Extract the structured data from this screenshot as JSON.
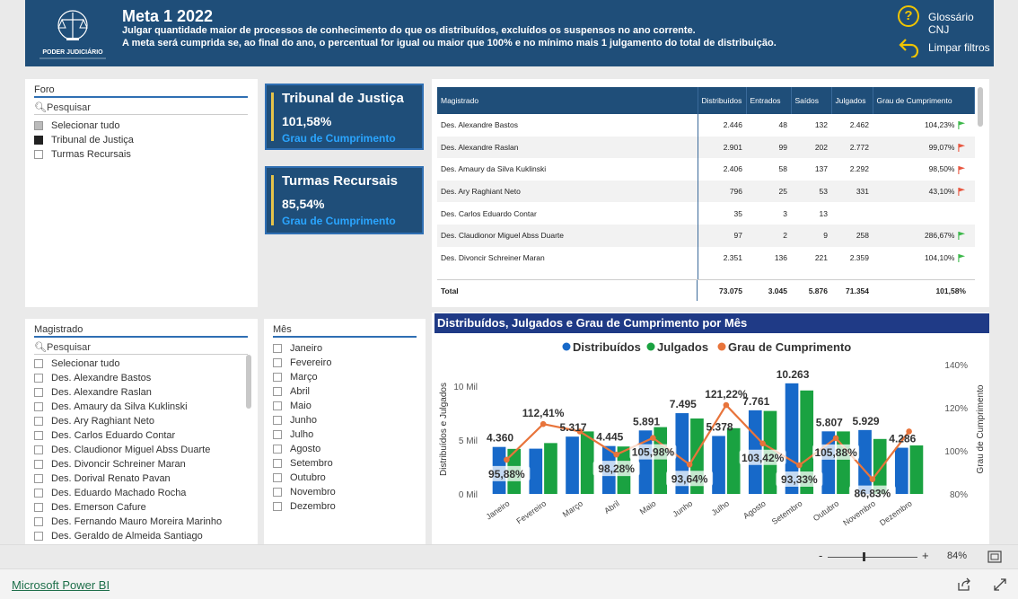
{
  "header": {
    "title": "Meta 1 2022",
    "desc1": "Julgar quantidade maior de processos de conhecimento do que os distribuídos, excluídos os suspensos no ano corrente.",
    "desc2": "A meta será cumprida se, ao final do ano, o percentual for igual ou maior que 100% e no mínimo mais 1 julgamento do total de distribuição.",
    "logo_text": "PODER JUDICIÁRIO",
    "glossario": "Glossário CNJ",
    "limpar": "Limpar filtros"
  },
  "foro_slicer": {
    "title": "Foro",
    "search": "Pesquisar",
    "options": [
      "Selecionar tudo",
      "Tribunal de Justiça",
      "Turmas Recursais"
    ]
  },
  "cards": [
    {
      "title": "Tribunal de Justiça",
      "value": "101,58%",
      "label": "Grau de Cumprimento"
    },
    {
      "title": "Turmas Recursais",
      "value": "85,54%",
      "label": "Grau de Cumprimento"
    }
  ],
  "table": {
    "headers": [
      "Magistrado",
      "Distribuídos",
      "Entrados",
      "Saídos",
      "Julgados",
      "Grau de Cumprimento"
    ],
    "rows": [
      {
        "name": "Des. Alexandre Bastos",
        "dist": "2.446",
        "ent": "48",
        "sai": "132",
        "jul": "2.462",
        "grau": "104,23%",
        "flag": "green"
      },
      {
        "name": "Des. Alexandre Raslan",
        "dist": "2.901",
        "ent": "99",
        "sai": "202",
        "jul": "2.772",
        "grau": "99,07%",
        "flag": "red"
      },
      {
        "name": "Des. Amaury da Silva Kuklinski",
        "dist": "2.406",
        "ent": "58",
        "sai": "137",
        "jul": "2.292",
        "grau": "98,50%",
        "flag": "red"
      },
      {
        "name": "Des. Ary Raghiant Neto",
        "dist": "796",
        "ent": "25",
        "sai": "53",
        "jul": "331",
        "grau": "43,10%",
        "flag": "red"
      },
      {
        "name": "Des. Carlos Eduardo Contar",
        "dist": "35",
        "ent": "3",
        "sai": "13",
        "jul": "",
        "grau": "",
        "flag": ""
      },
      {
        "name": "Des. Claudionor Miguel Abss Duarte",
        "dist": "97",
        "ent": "2",
        "sai": "9",
        "jul": "258",
        "grau": "286,67%",
        "flag": "green"
      },
      {
        "name": "Des. Divoncir Schreiner Maran",
        "dist": "2.351",
        "ent": "136",
        "sai": "221",
        "jul": "2.359",
        "grau": "104,10%",
        "flag": "green"
      }
    ],
    "total": {
      "label": "Total",
      "dist": "73.075",
      "ent": "3.045",
      "sai": "5.876",
      "jul": "71.354",
      "grau": "101,58%"
    }
  },
  "magistrado_slicer": {
    "title": "Magistrado",
    "search": "Pesquisar",
    "options": [
      "Selecionar tudo",
      "Des. Alexandre Bastos",
      "Des. Alexandre Raslan",
      "Des. Amaury da Silva Kuklinski",
      "Des. Ary Raghiant Neto",
      "Des. Carlos Eduardo Contar",
      "Des. Claudionor Miguel Abss Duarte",
      "Des. Divoncir Schreiner Maran",
      "Des. Dorival Renato Pavan",
      "Des. Eduardo Machado Rocha",
      "Des. Emerson Cafure",
      "Des. Fernando Mauro Moreira Marinho",
      "Des. Geraldo de Almeida Santiago"
    ]
  },
  "mes_slicer": {
    "title": "Mês",
    "options": [
      "Janeiro",
      "Fevereiro",
      "Março",
      "Abril",
      "Maio",
      "Junho",
      "Julho",
      "Agosto",
      "Setembro",
      "Outubro",
      "Novembro",
      "Dezembro"
    ]
  },
  "colors": {
    "dist": "#1769c9",
    "jul": "#1aa241",
    "grau": "#e8743b",
    "navy": "#1f4e79",
    "green_flag": "#3cb84a",
    "red_flag": "#e8563f"
  },
  "chart_data": {
    "type": "bar",
    "title": "Distribuídos, Julgados e Grau de Cumprimento por Mês",
    "categories": [
      "Janeiro",
      "Fevereiro",
      "Março",
      "Abril",
      "Maio",
      "Junho",
      "Julho",
      "Agosto",
      "Setembro",
      "Outubro",
      "Novembro",
      "Dezembro"
    ],
    "series": [
      {
        "name": "Distribuídos",
        "values": [
          4360,
          4200,
          5317,
          4445,
          5891,
          7495,
          5378,
          7761,
          10263,
          5807,
          5929,
          4286
        ],
        "labels": [
          "4.360",
          "",
          "5.317",
          "4.445",
          "5.891",
          "7.495",
          "5.378",
          "7.761",
          "10.263",
          "5.807",
          "5.929",
          "4.286"
        ]
      },
      {
        "name": "Julgados",
        "values": [
          4180,
          4720,
          5800,
          4400,
          6200,
          7000,
          6100,
          7700,
          9600,
          5800,
          5100,
          4500
        ]
      },
      {
        "name": "Grau de Cumprimento",
        "values": [
          95.88,
          112.41,
          109.0,
          98.28,
          105.98,
          93.64,
          121.22,
          103.42,
          93.33,
          105.88,
          86.83,
          109.0
        ],
        "labels": [
          "95,88%",
          "112,41%",
          "",
          "98,28%",
          "105,98%",
          "93,64%",
          "121,22%",
          "103,42%",
          "93,33%",
          "105,88%",
          "86,83%",
          ""
        ]
      }
    ],
    "ylabel": "Distribuídos e Julgados",
    "y2label": "Grau de Cumprimento",
    "ylim": [
      0,
      12000
    ],
    "yticks": [
      "0 Mil",
      "5 Mil",
      "10 Mil"
    ],
    "y2lim": [
      80,
      140
    ],
    "y2ticks": [
      "80%",
      "100%",
      "120%",
      "140%"
    ],
    "legend": "top"
  },
  "zoom": {
    "minus": "-",
    "plus": "+",
    "level": "84%"
  },
  "footer": {
    "brand": "Microsoft Power BI"
  }
}
